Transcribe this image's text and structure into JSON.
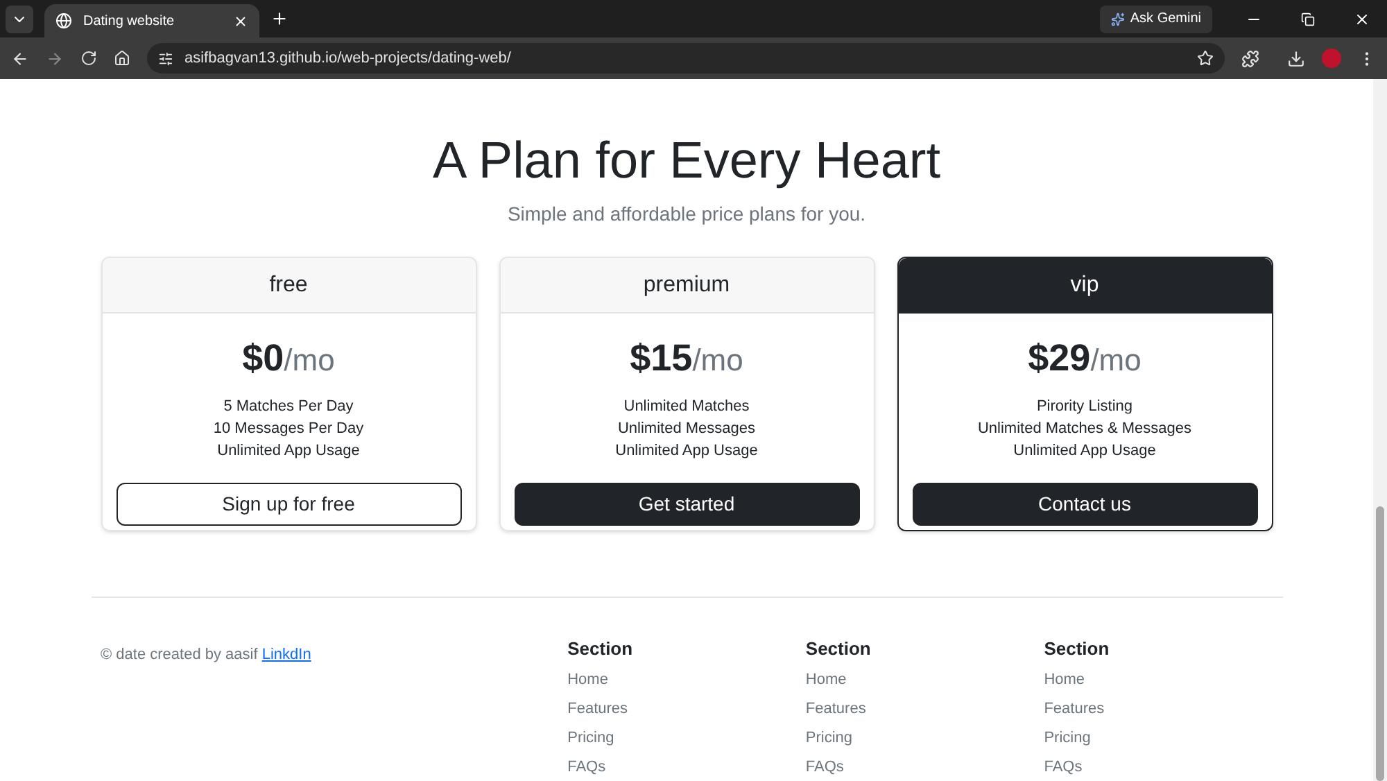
{
  "browser": {
    "tab_title": "Dating website",
    "url": "asifbagvan13.github.io/web-projects/dating-web/",
    "gemini_button": "Ask Gemini"
  },
  "pricing": {
    "title": "A Plan for Every Heart",
    "subtitle": "Simple and affordable price plans for you.",
    "plans": [
      {
        "name": "free",
        "price": "$0",
        "period": "/mo",
        "features": [
          "5 Matches Per Day",
          "10 Messages Per Day",
          "Unlimited App Usage"
        ],
        "button": "Sign up for free",
        "button_outlined": true,
        "highlighted": false
      },
      {
        "name": "premium",
        "price": "$15",
        "period": "/mo",
        "features": [
          "Unlimited Matches",
          "Unlimited Messages",
          "Unlimited App Usage"
        ],
        "button": "Get started",
        "button_outlined": false,
        "highlighted": false
      },
      {
        "name": "vip",
        "price": "$29",
        "period": "/mo",
        "features": [
          "Pirority Listing",
          "Unlimited Matches & Messages",
          "Unlimited App Usage"
        ],
        "button": "Contact us",
        "button_outlined": false,
        "highlighted": true
      }
    ]
  },
  "footer": {
    "copyright": "© date created by aasif",
    "link": "LinkdIn",
    "sections": [
      {
        "title": "Section",
        "links": [
          "Home",
          "Features",
          "Pricing",
          "FAQs"
        ]
      },
      {
        "title": "Section",
        "links": [
          "Home",
          "Features",
          "Pricing",
          "FAQs"
        ]
      },
      {
        "title": "Section",
        "links": [
          "Home",
          "Features",
          "Pricing",
          "FAQs"
        ]
      }
    ]
  }
}
